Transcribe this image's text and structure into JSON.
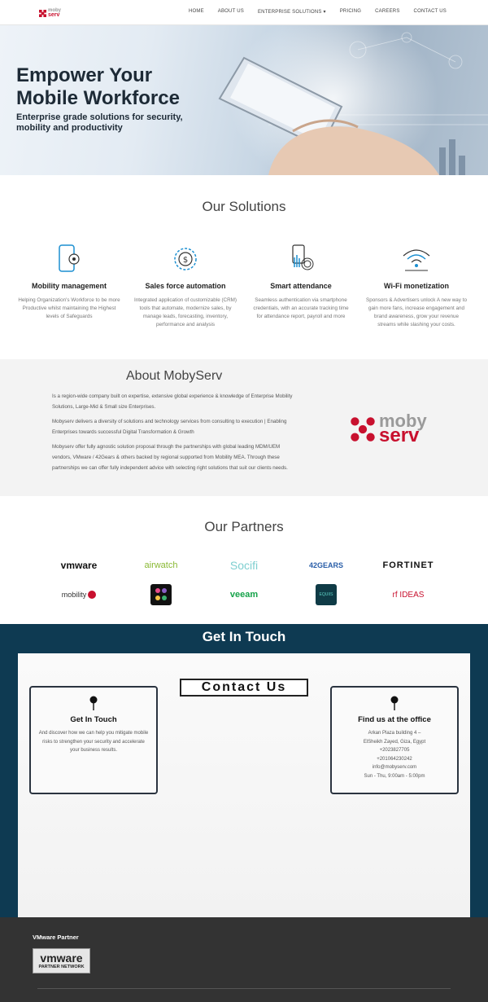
{
  "nav": {
    "logo_top": "moby",
    "logo_bottom": "serv",
    "items": [
      "HOME",
      "ABOUT US",
      "ENTERPRISE SOLUTIONS ▾",
      "PRICING",
      "CAREERS",
      "CONTACT US"
    ]
  },
  "hero": {
    "title_line1": "Empower Your",
    "title_line2": "Mobile Workforce",
    "subtitle_line1": "Enterprise grade solutions for security,",
    "subtitle_line2": "mobility and productivity"
  },
  "solutions": {
    "title": "Our Solutions",
    "items": [
      {
        "icon": "mobile-gear-icon",
        "title": "Mobility management",
        "text": "Helping Organization's Workforce to be more Productive whilst maintaining the Highest levels of Safeguards"
      },
      {
        "icon": "dollar-cycle-icon",
        "title": "Sales force automation",
        "text": "Integrated application of customizable (CRM) tools that automate, modernize sales, by manage leads, forecasting, inventory, performance and analysis"
      },
      {
        "icon": "fingerprint-icon",
        "title": "Smart attendance",
        "text": "Seamless authentication via smartphone credentials, with an accurate tracking time for attendance report, payroll and more"
      },
      {
        "icon": "wifi-icon",
        "title": "Wi-Fi monetization",
        "text": "Sponsors & Advertisers unlock A new way to gain more fans, increase engagement and brand awareness, grow your revenue streams while slashing your costs."
      }
    ]
  },
  "about": {
    "title": "About MobyServ",
    "p1": "Is a region-wide company built on expertise, extensive global experience & knowledge of Enterprise Mobility Solutions, Large-Mid & Small size Enterprises.",
    "p2": "Mobyserv delivers a diversity of solutions and technology services from consulting to execution | Enabling Enterprises towards successful Digital Transformation & Growth",
    "p3": "Mobyserv offer fully agnostic solution proposal through the partnerships with global leading MDM/UEM vendors, VMware / 42Gears & others backed by regional supported from Mobility MEA.  Through these partnerships we can offer fully independent advice with selecting right solutions that suit our clients needs.",
    "logo_top": "moby",
    "logo_bottom": "serv"
  },
  "partners": {
    "title": "Our Partners",
    "row1": [
      "vmware",
      "airwatch",
      "Socifi",
      "42GEARS",
      "FORTINET"
    ],
    "row2": [
      "mobility",
      "",
      "veeam",
      "EQUIIS",
      "rf IDEAS"
    ]
  },
  "touch": {
    "title": "Get In Touch",
    "contact_title": "Contact Us",
    "left_card": {
      "title": "Get In Touch",
      "text": "And discover how we can help you mitigate mobile risks to strengthen your security and accelerate your business results."
    },
    "right_card": {
      "title": "Find us at the office",
      "lines": [
        "Arkan Plaza building 4 –",
        "ElSheikh Zayed, Giza, Egypt",
        "+2023827705",
        "+201064230242",
        "info@mobyserv.com",
        "Sun - Thu, 9:00am - 5:00pm"
      ]
    }
  },
  "footer": {
    "heading": "VMware Partner",
    "badge_top": "vmware",
    "badge_bottom": "PARTNER NETWORK"
  },
  "colors": {
    "brand_red": "#c8102e",
    "touch_bg": "#0e3a52",
    "footer_bg": "#333333"
  }
}
